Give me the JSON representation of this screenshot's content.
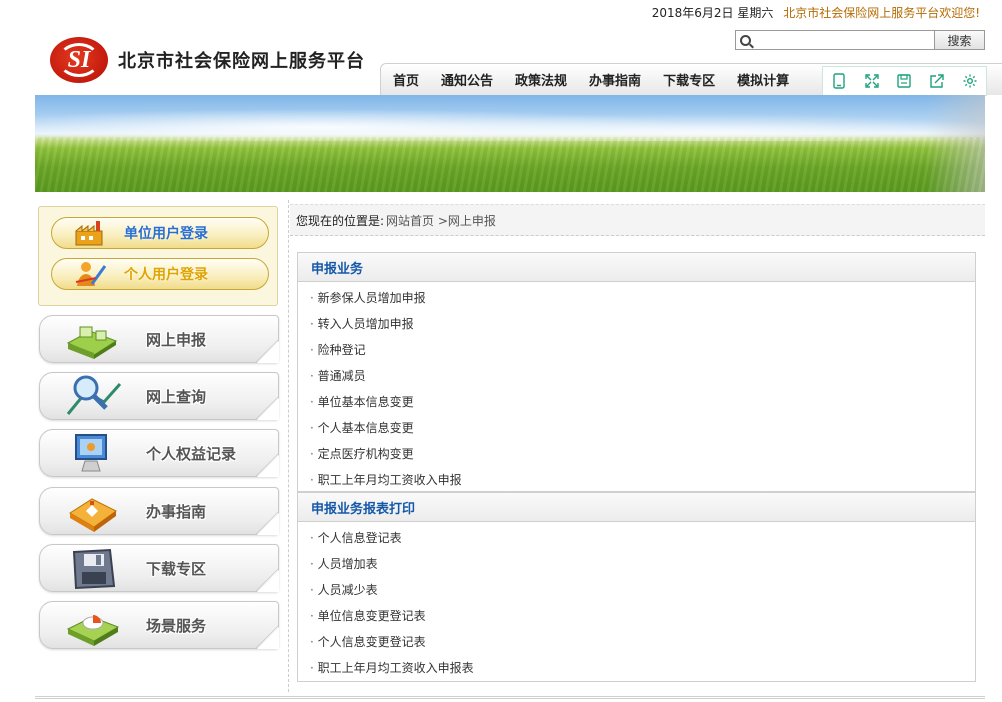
{
  "topbar": {
    "date": "2018年6月2日 星期六",
    "welcome": "北京市社会保险网上服务平台欢迎您!"
  },
  "header": {
    "logo_mark": "SI",
    "site_title": "北京市社会保险网上服务平台"
  },
  "search": {
    "button_label": "搜索",
    "value": ""
  },
  "nav": {
    "items": [
      "首页",
      "通知公告",
      "政策法规",
      "办事指南",
      "下载专区",
      "模拟计算"
    ]
  },
  "share_icons": [
    "tablet-icon",
    "fullscreen-icon",
    "save-icon",
    "share-icon",
    "settings-icon"
  ],
  "sidebar": {
    "login": {
      "unit_label": "单位用户登录",
      "person_label": "个人用户登录"
    },
    "items": [
      {
        "label": "网上申报",
        "icon": "online-declare-icon"
      },
      {
        "label": "网上查询",
        "icon": "online-query-icon"
      },
      {
        "label": "个人权益记录",
        "icon": "personal-record-icon"
      },
      {
        "label": "办事指南",
        "icon": "guide-icon"
      },
      {
        "label": "下载专区",
        "icon": "download-icon"
      },
      {
        "label": "场景服务",
        "icon": "scene-service-icon"
      }
    ]
  },
  "breadcrumb": {
    "label": "您现在的位置是:",
    "path": "网站首页 >网上申报"
  },
  "panels": [
    {
      "title": "申报业务",
      "items": [
        "新参保人员增加申报",
        "转入人员增加申报",
        "险种登记",
        "普通减员",
        "单位基本信息变更",
        "个人基本信息变更",
        "定点医疗机构变更",
        "职工上年月均工资收入申报"
      ]
    },
    {
      "title": "申报业务报表打印",
      "items": [
        "个人信息登记表",
        "人员增加表",
        "人员减少表",
        "单位信息变更登记表",
        "个人信息变更登记表",
        "职工上年月均工资收入申报表"
      ]
    }
  ],
  "colors": {
    "brand_red": "#c41a0e",
    "panel_title": "#1558a8",
    "welcome": "#b56a00",
    "share_icon": "#1ea27a"
  }
}
